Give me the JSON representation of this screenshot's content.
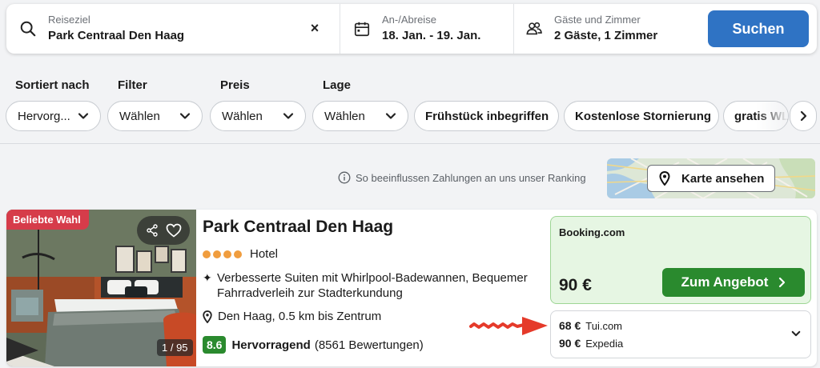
{
  "search": {
    "destination_label": "Reiseziel",
    "destination_value": "Park Centraal Den Haag",
    "clear_symbol": "×",
    "dates_label": "An-/Abreise",
    "dates_value": "18. Jan. - 19. Jan.",
    "guests_label": "Gäste und Zimmer",
    "guests_value": "2 Gäste, 1 Zimmer",
    "search_button": "Suchen"
  },
  "filters": {
    "sort": {
      "label": "Sortiert nach",
      "value": "Hervorg..."
    },
    "filter": {
      "label": "Filter",
      "value": "Wählen"
    },
    "price": {
      "label": "Preis",
      "value": "Wählen"
    },
    "location": {
      "label": "Lage",
      "value": "Wählen"
    },
    "chips": [
      "Frühstück inbegriffen",
      "Kostenlose Stornierung",
      "gratis WLAN"
    ]
  },
  "ranking_note": "So beeinflussen Zahlungen an uns unser Ranking",
  "map_button": "Karte ansehen",
  "hotel": {
    "badge": "Beliebte Wahl",
    "photo_counter": "1 / 95",
    "name": "Park Centraal Den Haag",
    "stars": 4,
    "type": "Hotel",
    "feature": "Verbesserte Suiten mit Whirlpool-Badewannen, Bequemer Fahrradverleih zur Stadterkundung",
    "location": "Den Haag, 0.5 km bis Zentrum",
    "score": "8.6",
    "rating_word": "Hervorragend",
    "reviews": "(8561 Bewertungen)",
    "deal": {
      "provider": "Booking.com",
      "price": "90 €",
      "button": "Zum Angebot"
    },
    "other_offers": [
      {
        "price": "68 €",
        "provider": "Tui.com"
      },
      {
        "price": "90 €",
        "provider": "Expedia"
      }
    ]
  },
  "colors": {
    "primary_blue": "#2f73c4",
    "deal_green": "#2a8a2e",
    "badge_red": "#d63c4a",
    "star_orange": "#f09d3e",
    "annotation_red": "#e53a2a"
  },
  "icons": [
    "search-icon",
    "close-icon",
    "calendar-icon",
    "guests-icon",
    "chevron-down-icon",
    "chevron-right-icon",
    "info-icon",
    "map-pin-icon",
    "share-icon",
    "heart-icon",
    "sparkle-icon",
    "location-pin-icon"
  ]
}
